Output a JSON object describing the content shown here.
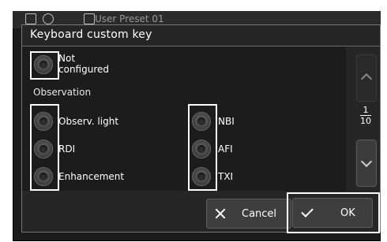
{
  "background": {
    "title": "User Preset 01"
  },
  "dialog": {
    "title": "Keyboard custom key",
    "not_configured_label": "Not\nconfigured",
    "section_label": "Observation",
    "left_options": [
      "Observ. light",
      "RDI",
      "Enhancement"
    ],
    "right_options": [
      "NBI",
      "AFI",
      "TXI"
    ]
  },
  "pagination": {
    "current": "1",
    "total": "10"
  },
  "buttons": {
    "cancel_label": "Cancel",
    "ok_label": "OK"
  },
  "colors": {
    "highlight": "#ffffff",
    "dialog_bg": "#262626",
    "button_bg": "#3e3e3e"
  }
}
